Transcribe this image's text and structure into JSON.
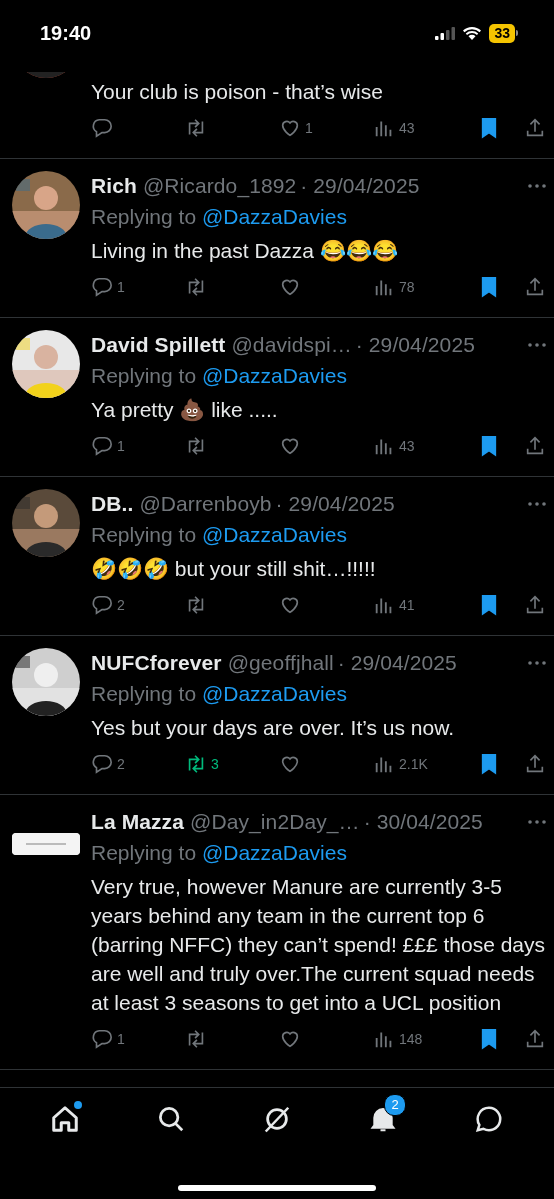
{
  "status_bar": {
    "time": "19:40",
    "battery": "33"
  },
  "tweets": [
    {
      "text": "Your club is poison - that’s wise",
      "retweeted": false,
      "likes": "1",
      "liked": false,
      "views": "43",
      "bookmarked": true
    },
    {
      "name": "Rich",
      "handle": "@Ricardo_1892",
      "date": "· 29/04/2025",
      "replying_prefix": "Replying to",
      "replying_to": "@DazzaDavies",
      "text": "Living in the past Dazza 😂😂😂",
      "replies": "1",
      "retweeted": false,
      "liked": false,
      "views": "78",
      "bookmarked": true
    },
    {
      "name": "David Spillett",
      "handle": "@davidspi…",
      "date": "· 29/04/2025",
      "replying_prefix": "Replying to",
      "replying_to": "@DazzaDavies",
      "text": "Ya pretty 💩 like .....",
      "replies": "1",
      "retweeted": false,
      "liked": false,
      "views": "43",
      "bookmarked": true
    },
    {
      "name": "DB..",
      "handle": "@Darrenboyb",
      "date": "· 29/04/2025",
      "replying_prefix": "Replying to",
      "replying_to": "@DazzaDavies",
      "text": "🤣🤣🤣 but your still shit…!!!!!",
      "replies": "2",
      "retweeted": false,
      "liked": false,
      "views": "41",
      "bookmarked": true
    },
    {
      "name": "NUFCforever",
      "handle": "@geoffjhall",
      "date": "· 29/04/2025",
      "replying_prefix": "Replying to",
      "replying_to": "@DazzaDavies",
      "text": "Yes but your days are over. It’s us now.",
      "replies": "2",
      "retweets": "3",
      "retweeted": true,
      "liked": false,
      "views": "2.1K",
      "bookmarked": true
    },
    {
      "avatar": {
        "kind": "banner"
      },
      "name": "La Mazza",
      "handle": "@Day_in2Day_…",
      "date": "· 30/04/2025",
      "replying_prefix": "Replying to",
      "replying_to": "@DazzaDavies",
      "text": "Very true, however Manure are currently 3-5 years behind any team in the current top 6 (barring NFFC) they can’t spend! £££ those days are well and truly over.The current squad needs at least 3 seasons to get into a UCL position",
      "replies": "1",
      "retweeted": false,
      "liked": false,
      "views": "148",
      "bookmarked": true
    }
  ],
  "nav": [
    {
      "kind": "home",
      "selected": true,
      "has_new": true
    },
    {
      "kind": "search",
      "selected": false,
      "has_new": false
    },
    {
      "kind": "grok",
      "selected": false,
      "has_new": false
    },
    {
      "kind": "notifications",
      "selected": false,
      "has_new": false,
      "badge": "2"
    },
    {
      "kind": "messages",
      "selected": false,
      "has_new": false
    }
  ]
}
